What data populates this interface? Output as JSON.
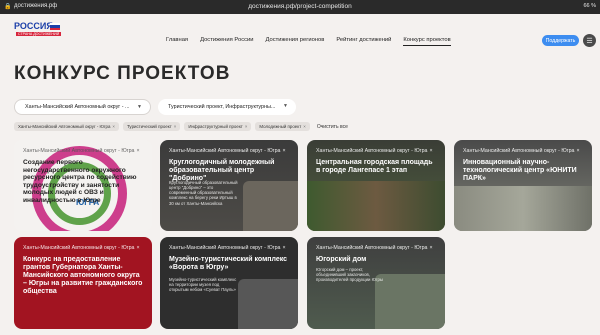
{
  "browser": {
    "left_url": "достижения.рф",
    "url": "достижения.рф/project-competition",
    "battery": "66 %"
  },
  "logo": {
    "word": "РОССИЯ",
    "subtitle": "СТРАНА ДОСТИЖЕНИЙ"
  },
  "nav": [
    "Главная",
    "Достижения России",
    "Достижения регионов",
    "Рейтинг достижений",
    "Конкурс проектов"
  ],
  "submit_label": "Поддержать",
  "page_title": "КОНКУРС ПРОЕКТОВ",
  "filters": {
    "region": "Ханты-Мансийский Автономный округ - ...",
    "category": "Туристический проект, Инфраструктурны..."
  },
  "chips": [
    "Ханты-Мансийский Автономный округ - Югра",
    "Туристический проект",
    "Инфраструктурный проект",
    "Молодежный проект"
  ],
  "clear_label": "Очистить все",
  "cards": [
    {
      "region": "Ханты-Мансийский Автономный округ - Югра",
      "title": "Создание первого негосударственного окружного ресурсного центра по содействию трудоустройству и занятости молодых людей с ОВЗ и инвалидностью в Югре",
      "desc": "",
      "seal_text": "ЮГРА"
    },
    {
      "region": "Ханты-Мансийский Автономный округ - Югра",
      "title": "Круглогодичный молодежный образовательный центр \"Добрино\"",
      "desc": "Круглогодичный образовательный центр \"Добрино\" – это современный образовательный комплекс на берегу реки Иртыш в 30 км от Ханты-Мансийска"
    },
    {
      "region": "Ханты-Мансийский Автономный округ - Югра",
      "title": "Центральная городская площадь в городе Лангепасе 1 этап",
      "desc": ""
    },
    {
      "region": "Ханты-Мансийский Автономный округ - Югра",
      "title": "Инновационный научно-технологический центр «ЮНИТИ ПАРК»",
      "desc": ""
    },
    {
      "region": "Ханты-Мансийский Автономный округ - Югра",
      "title": "Конкурс на предоставление грантов Губернатора Ханты-Мансийского автономного округа – Югры на развитие гражданского общества",
      "desc": ""
    },
    {
      "region": "Ханты-Мансийский Автономный округ - Югра",
      "title": "Музейно-туристический комплекс «Ворота в Югру»",
      "desc": "Музейно-туристический комплекс на территории музея под открытым небом «Суеват Пауль»"
    },
    {
      "region": "Ханты-Мансийский Автономный округ - Югра",
      "title": "Югорский дом",
      "desc": "Югорский дом – проект, объединивший заказчиков, производителей продукции Югры"
    }
  ],
  "colors": {
    "accent": "#3d8df0",
    "brand_red": "#d7263d",
    "red_card": "#a21421"
  }
}
